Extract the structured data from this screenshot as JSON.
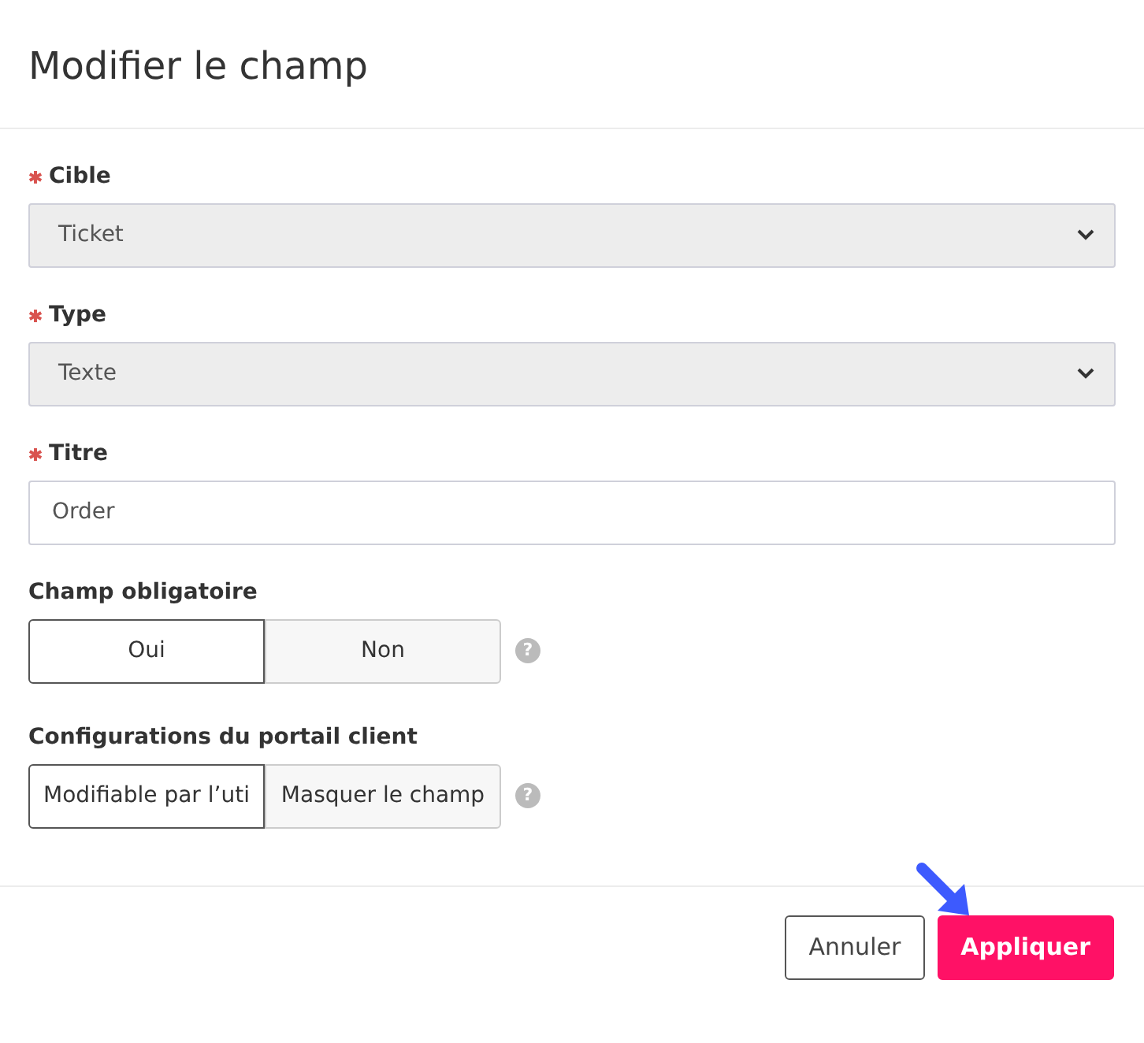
{
  "dialog": {
    "title": "Modifier le champ"
  },
  "fields": [
    {
      "kind": "select",
      "label": "Cible",
      "required": true,
      "value": "Ticket"
    },
    {
      "kind": "select",
      "label": "Type",
      "required": true,
      "value": "Texte"
    },
    {
      "kind": "text",
      "label": "Titre",
      "required": true,
      "value": "Order"
    },
    {
      "kind": "toggle",
      "label": "Champ obligatoire",
      "required": false,
      "options": [
        {
          "label": "Oui",
          "selected": true
        },
        {
          "label": "Non",
          "selected": false
        }
      ],
      "help": "?"
    },
    {
      "kind": "toggle",
      "label": "Configurations du portail client",
      "required": false,
      "options": [
        {
          "label": "Modifiable par l’uti",
          "selected": true
        },
        {
          "label": "Masquer le champ",
          "selected": false
        }
      ],
      "help": "?"
    }
  ],
  "buttons": [
    {
      "label": "Annuler",
      "kind": "secondary"
    },
    {
      "label": "Appliquer",
      "kind": "primary"
    }
  ]
}
